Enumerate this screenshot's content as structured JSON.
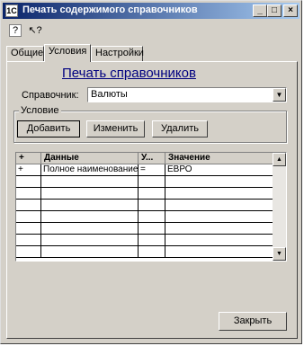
{
  "window": {
    "title": "Печать содержимого справочников",
    "icon_label": "1С",
    "minimize": "_",
    "maximize": "□",
    "close": "×"
  },
  "toolbar": {
    "help_glyph": "?",
    "pointer_help_glyph": "↖?"
  },
  "tabs": [
    {
      "label": "Общие",
      "active": false
    },
    {
      "label": "Условия",
      "active": true
    },
    {
      "label": "Настройки",
      "active": false
    }
  ],
  "heading": "Печать справочников",
  "catalog": {
    "label": "Справочник:",
    "value": "Валюты",
    "dropdown_glyph": "▼"
  },
  "condition_group": {
    "label": "Условие",
    "buttons": {
      "add": "Добавить",
      "edit": "Изменить",
      "delete": "Удалить"
    }
  },
  "grid": {
    "columns": [
      "+",
      "Данные",
      "У...",
      "Значение"
    ],
    "rows": [
      [
        "+",
        "Полное наименование",
        "=",
        "ЕВРО"
      ],
      [
        "",
        "",
        "",
        ""
      ],
      [
        "",
        "",
        "",
        ""
      ],
      [
        "",
        "",
        "",
        ""
      ],
      [
        "",
        "",
        "",
        ""
      ],
      [
        "",
        "",
        "",
        ""
      ],
      [
        "",
        "",
        "",
        ""
      ],
      [
        "",
        "",
        "",
        ""
      ]
    ],
    "scroll_up": "▲",
    "scroll_down": "▼"
  },
  "footer": {
    "close_label": "Закрыть"
  }
}
